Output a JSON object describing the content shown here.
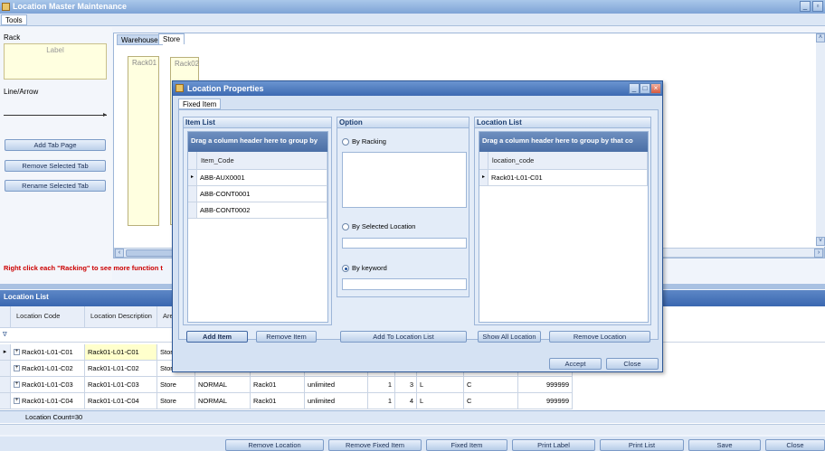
{
  "window": {
    "title": "Location Master Maintenance"
  },
  "menu": {
    "tools": "Tools"
  },
  "left": {
    "rack_label": "Rack",
    "label_box": "Label",
    "linearrow_label": "Line/Arrow",
    "add_tab": "Add Tab Page",
    "remove_tab": "Remove Selected Tab",
    "rename_tab": "Rename Selected Tab",
    "hint": "Right click each \"Racking\" to see more function t"
  },
  "tabs": {
    "warehouse": "Warehouse",
    "store": "Store"
  },
  "racks": [
    "Rack01",
    "Rack02"
  ],
  "location_list": {
    "title": "Location List",
    "columns": [
      "Location Code",
      "Location Description",
      "Are"
    ],
    "rows": [
      {
        "code": "Rack01-L01-C01",
        "desc": "Rack01-L01-C01",
        "area": "Store",
        "type": "",
        "rack": "",
        "cap": "",
        "a": "",
        "b": "",
        "c": "",
        "d": "",
        "e": ""
      },
      {
        "code": "Rack01-L01-C02",
        "desc": "Rack01-L01-C02",
        "area": "Stor",
        "type": "",
        "rack": "",
        "cap": "",
        "a": "",
        "b": "",
        "c": "",
        "d": "",
        "e": ""
      },
      {
        "code": "Rack01-L01-C03",
        "desc": "Rack01-L01-C03",
        "area": "Store",
        "type": "NORMAL",
        "rack": "Rack01",
        "cap": "unlimited",
        "a": "1",
        "b": "3",
        "c": "L",
        "d": "C",
        "e": "999999"
      },
      {
        "code": "Rack01-L01-C04",
        "desc": "Rack01-L01-C04",
        "area": "Store",
        "type": "NORMAL",
        "rack": "Rack01",
        "cap": "unlimited",
        "a": "1",
        "b": "4",
        "c": "L",
        "d": "C",
        "e": "999999"
      }
    ],
    "count": "Location Count=30"
  },
  "bottom_buttons": [
    "Remove Location",
    "Remove Fixed Item",
    "Fixed Item",
    "Print Label",
    "Print List",
    "Save",
    "Close"
  ],
  "dialog": {
    "title": "Location Properties",
    "tab": "Fixed Item",
    "item_list": {
      "title": "Item List",
      "drag_hint": "Drag a column header here to group by",
      "column": "Item_Code",
      "rows": [
        "ABB-AUX0001",
        "ABB-CONT0001",
        "ABB-CONT0002"
      ]
    },
    "option": {
      "title": "Option",
      "by_racking": "By Racking",
      "by_selected": "By Selected Location",
      "by_keyword": "By keyword"
    },
    "location_list": {
      "title": "Location List",
      "drag_hint": "Drag a column header here to group by that co",
      "column": "location_code",
      "rows": [
        "Rack01-L01-C01"
      ]
    },
    "buttons": {
      "add_item": "Add Item",
      "remove_item": "Remove Item",
      "add_to_location": "Add To Location List",
      "show_all": "Show All Location",
      "remove_location": "Remove Location",
      "accept": "Accept",
      "close": "Close"
    }
  }
}
